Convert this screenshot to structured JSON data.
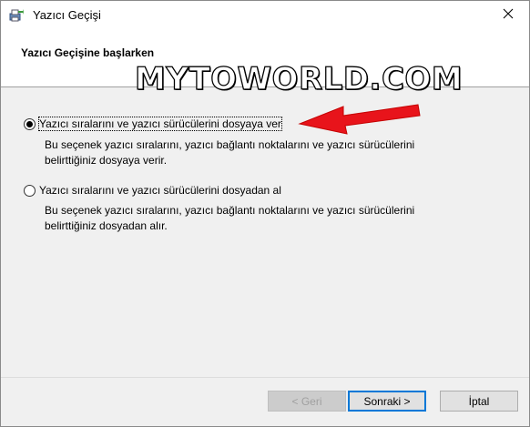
{
  "window": {
    "title": "Yazıcı Geçişi"
  },
  "header": {
    "title": "Yazıcı Geçişine başlarken"
  },
  "watermark": "MYTOWORLD.COM",
  "options": [
    {
      "label": "Yazıcı sıralarını ve yazıcı sürücülerini dosyaya ver",
      "selected": true,
      "description_line1": "Bu seçenek yazıcı sıralarını, yazıcı bağlantı noktalarını ve yazıcı sürücülerini",
      "description_line2": "belirttiğiniz dosyaya verir."
    },
    {
      "label": "Yazıcı sıralarını ve yazıcı sürücülerini dosyadan al",
      "selected": false,
      "description_line1": "Bu seçenek yazıcı sıralarını, yazıcı bağlantı noktalarını ve yazıcı sürücülerini",
      "description_line2": "belirttiğiniz dosyadan alır."
    }
  ],
  "buttons": {
    "back": "< Geri",
    "next": "Sonraki >",
    "cancel": "İptal"
  },
  "colors": {
    "arrow": "#e8141b",
    "focus_border": "#0078d7"
  },
  "icons": [
    "printer-migration-icon",
    "close-icon",
    "red-arrow-icon"
  ]
}
